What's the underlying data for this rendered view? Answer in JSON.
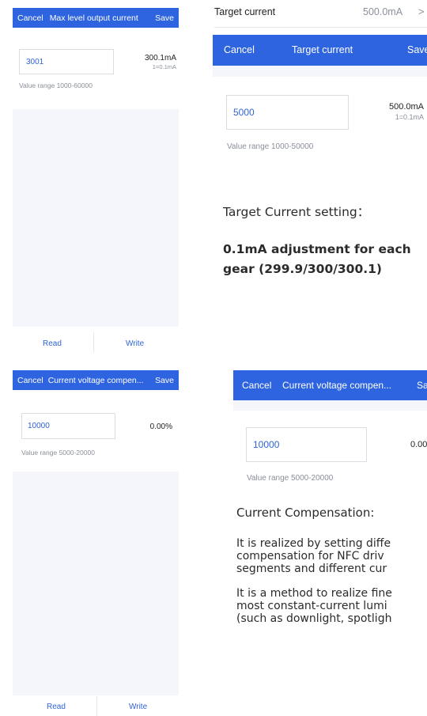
{
  "tl": {
    "bar": {
      "cancel": "Cancel",
      "title": "Max level output current",
      "save": "Save"
    },
    "input_value": "3001",
    "readout_value": "300.1mA",
    "readout_unit": "1=0.1mA",
    "range": "Value range 1000-60000",
    "read": "Read",
    "write": "Write"
  },
  "tr": {
    "row_label": "Target current",
    "row_value": "500.0mA",
    "row_chevron": ">",
    "bar": {
      "cancel": "Cancel",
      "title": "Target current",
      "save": "Save"
    },
    "input_value": "5000",
    "readout_value": "500.0mA",
    "readout_unit": "1=0.1mA",
    "range": "Value range 1000-50000",
    "note_title": "Target Current setting：",
    "note_line1": "0.1mA adjustment for each",
    "note_line2": "gear (299.9/300/300.1)"
  },
  "bl": {
    "bar": {
      "cancel": "Cancel",
      "title": "Current voltage compen...",
      "save": "Save"
    },
    "input_value": "10000",
    "readout_value": "0.00%",
    "range": "Value range 5000-20000",
    "read": "Read",
    "write": "Write"
  },
  "br": {
    "bar": {
      "cancel": "Cancel",
      "title": "Current voltage compen...",
      "save": "Sa"
    },
    "input_value": "10000",
    "readout_value": "0.00",
    "range": "Value range 5000-20000",
    "note_title": "Current Compensation:",
    "para1_line1": "It is realized by setting diffe",
    "para1_line2": "compensation for NFC driv",
    "para1_line3": "segments and different cur",
    "para2_line1": "It is a method to realize fine",
    "para2_line2": "most constant-current lumi",
    "para2_line3": "(such as downlight, spotligh"
  },
  "colors": {
    "accent": "#2e64e0",
    "panel": "#f5f6fb",
    "link": "#2f63d6"
  }
}
